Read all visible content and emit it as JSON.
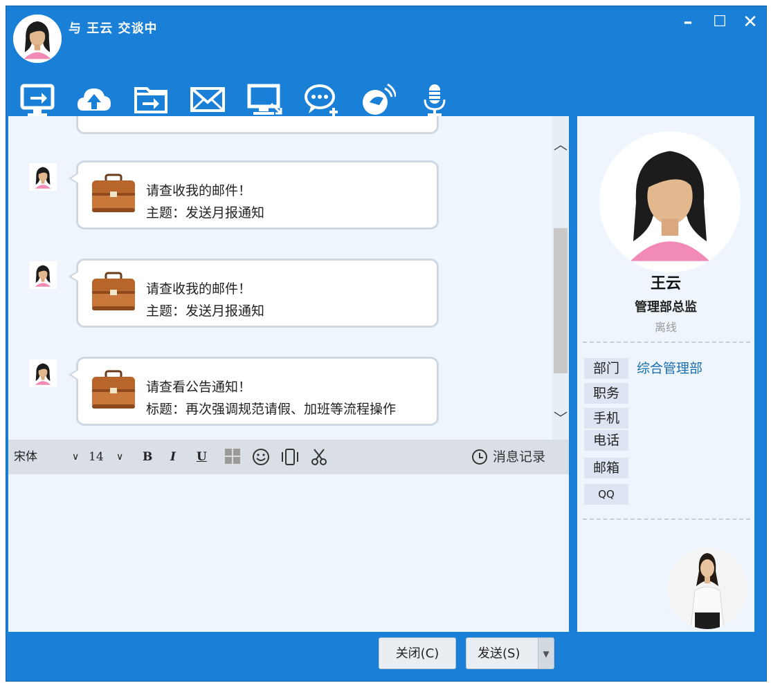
{
  "window": {
    "title": "与 王云 交谈中",
    "minimize": "–",
    "maximize": "☐",
    "close": "✕"
  },
  "toolbar": {
    "items": [
      {
        "name": "screen-share-icon"
      },
      {
        "name": "upload-icon"
      },
      {
        "name": "send-folder-icon"
      },
      {
        "name": "mail-icon"
      },
      {
        "name": "remote-desktop-icon"
      },
      {
        "name": "group-chat-icon"
      },
      {
        "name": "voice-call-icon"
      },
      {
        "name": "microphone-icon"
      }
    ]
  },
  "messages": [
    {
      "line1": "请查收我的邮件！",
      "line2": "主题：发送月报通知"
    },
    {
      "line1": "请查收我的邮件！",
      "line2": "主题：发送月报通知"
    },
    {
      "line1": "请查看公告通知！",
      "line2": "标题：再次强调规范请假、加班等流程操作"
    }
  ],
  "format": {
    "font": "宋体",
    "size": "14",
    "bold": "B",
    "italic": "I",
    "underline": "U",
    "history": "消息记录"
  },
  "contact": {
    "name": "王云",
    "title": "管理部总监",
    "status": "离线",
    "fields": [
      {
        "label": "部门",
        "value": "综合管理部"
      },
      {
        "label": "职务",
        "value": ""
      },
      {
        "label": "手机",
        "value": ""
      },
      {
        "label": "电话",
        "value": ""
      },
      {
        "label": "邮箱",
        "value": ""
      },
      {
        "label": "QQ",
        "value": ""
      }
    ]
  },
  "buttons": {
    "close": "关闭(C)",
    "send": "发送(S)"
  },
  "colors": {
    "accent": "#1a7fd6",
    "panel_bg": "#eef5fc",
    "link": "#1a6fb0"
  }
}
